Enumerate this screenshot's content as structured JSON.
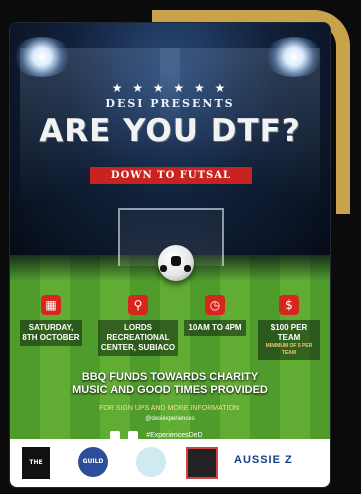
{
  "header": {
    "stars": "★ ★ ★ ★ ★ ★",
    "presents": "DESI PRESENTS",
    "title": "ARE YOU DTF?",
    "banner": "DOWN TO FUTSAL"
  },
  "details": [
    {
      "icon": "calendar-icon",
      "text": "SATURDAY, 8TH OCTOBER",
      "sub": ""
    },
    {
      "icon": "location-icon",
      "text": "LORDS RECREATIONAL CENTER, SUBIACO",
      "sub": ""
    },
    {
      "icon": "clock-icon",
      "text": "10AM TO 4PM",
      "sub": ""
    },
    {
      "icon": "dollar-icon",
      "text": "$100 PER TEAM",
      "sub": "MINIMUM OF 5 PER TEAM"
    }
  ],
  "tagline": {
    "line1": "BBQ FUNDS TOWARDS CHARITY",
    "line2": "MUSIC AND GOOD TIMES PROVIDED"
  },
  "signup": "FOR SIGN UPS AND MORE INFORMATION:",
  "handle": "@desiexperiences",
  "hashtag": "#ExperiencesDeD",
  "sponsors": [
    "THE GUILD",
    "GUILD",
    "",
    "",
    "AUSSIE Z"
  ],
  "colors": {
    "accent": "#c8231f",
    "frame": "#c9a24c",
    "pitch": "#4f9b2c"
  }
}
